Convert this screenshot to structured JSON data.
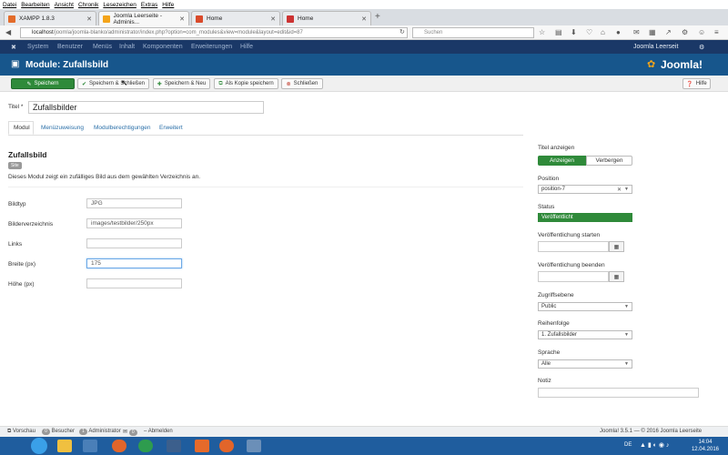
{
  "menubar": [
    "Datei",
    "Bearbeiten",
    "Ansicht",
    "Chronik",
    "Lesezeichen",
    "Extras",
    "Hilfe"
  ],
  "tabs": [
    {
      "label": "XAMPP 1.8.3",
      "icon_color": "#e36c2b"
    },
    {
      "label": "Joomla Leerseite - Adminis...",
      "icon_color": "#f4a41a"
    },
    {
      "label": "Home",
      "icon_color": "#d94a2b"
    },
    {
      "label": "Home",
      "icon_color": "#c33"
    }
  ],
  "url": {
    "host": "localhost",
    "path": "/joomla/joomla-blanko/administrator/index.php?option=com_modules&view=module&layout=edit&id=87"
  },
  "search": {
    "placeholder": "Suchen"
  },
  "jnav": {
    "items": [
      "System",
      "Benutzer",
      "Menüs",
      "Inhalt",
      "Komponenten",
      "Erweiterungen",
      "Hilfe"
    ],
    "site": "Joomla Leerseit"
  },
  "header": {
    "title": "Module: Zufallsbild",
    "logo": "Joomla!"
  },
  "toolbar": {
    "save": "Speichern",
    "save_close": "Speichern & Schließen",
    "save_new": "Speichern & Neu",
    "save_copy": "Als Kopie speichern",
    "close": "Schließen",
    "help": "Hilfe"
  },
  "title_field": {
    "label": "Titel *",
    "value": "Zufallsbilder"
  },
  "module_tabs": [
    "Modul",
    "Menüzuweisung",
    "Modulberechtigungen",
    "Erweitert"
  ],
  "module": {
    "name": "Zufallsbild",
    "badge": "Site",
    "description": "Dieses Modul zeigt ein zufälliges Bild aus dem gewählten Verzeichnis an."
  },
  "fields": [
    {
      "label": "Bildtyp",
      "value": "JPG"
    },
    {
      "label": "Bilderverzeichnis",
      "value": "images/testbilder/250px"
    },
    {
      "label": "Links",
      "value": ""
    },
    {
      "label": "Breite (px)",
      "value": "175"
    },
    {
      "label": "Höhe (px)",
      "value": ""
    }
  ],
  "right": {
    "show_title_label": "Titel anzeigen",
    "show_label": "Anzeigen",
    "hide_label": "Verbergen",
    "position_label": "Position",
    "position_value": "position-7",
    "status_label": "Status",
    "status_value": "Veröffentlicht",
    "publish_start_label": "Veröffentlichung starten",
    "publish_end_label": "Veröffentlichung beenden",
    "access_label": "Zugriffsebene",
    "access_value": "Public",
    "order_label": "Reihenfolge",
    "order_value": "1. Zufallsbilder",
    "language_label": "Sprache",
    "language_value": "Alle",
    "note_label": "Notiz"
  },
  "statusbar": {
    "preview": "Vorschau",
    "visitors_count": "0",
    "visitors": "Besucher",
    "admin_count": "1",
    "admin": "Administrator",
    "msg_count": "0",
    "logout": "Abmelden",
    "version": "Joomla! 3.5.1 — © 2016 Joomla Leerseite"
  },
  "taskbar": {
    "lang": "DE",
    "time": "14:04",
    "date": "12.04.2016"
  },
  "colors": {
    "primary": "#17568c",
    "nav": "#1a3867",
    "green": "#2f8a3a"
  }
}
